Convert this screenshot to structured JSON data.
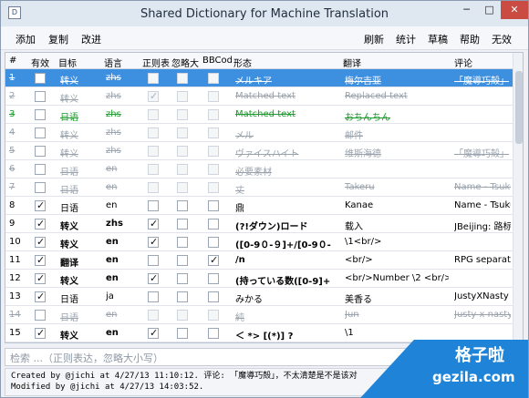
{
  "window": {
    "title": "Shared Dictionary for Machine Translation",
    "icon": "app-icon",
    "min_glyph": "─",
    "max_glyph": "□",
    "close_glyph": "✕"
  },
  "menu": {
    "left": [
      "添加",
      "复制",
      "改进"
    ],
    "right": [
      "刷新",
      "统计",
      "草稿",
      "帮助",
      "无效"
    ]
  },
  "table": {
    "headers": [
      "#",
      "有效",
      "目标",
      "语言",
      "正则表",
      "忽略大",
      "BBCod",
      "形态",
      "翻译",
      "评论"
    ],
    "rows": [
      {
        "n": "1",
        "valid": false,
        "target": "转义",
        "lang": "zhs",
        "regex": false,
        "ignore": false,
        "bbcode": false,
        "form": "メルキア",
        "translation": "梅尔吉亚",
        "comment": "「魔導巧殻」"
      },
      {
        "n": "2",
        "valid": false,
        "target": "转义",
        "lang": "zhs",
        "regex": true,
        "ignore": false,
        "bbcode": false,
        "form": "Matched text",
        "translation": "Replaced text",
        "comment": ""
      },
      {
        "n": "3",
        "valid": false,
        "target": "日语",
        "lang": "zhs",
        "regex": false,
        "ignore": false,
        "bbcode": false,
        "form": "Matched text",
        "translation": "おちんちん",
        "comment": ""
      },
      {
        "n": "4",
        "valid": false,
        "target": "转义",
        "lang": "zhs",
        "regex": false,
        "ignore": false,
        "bbcode": false,
        "form": "メル",
        "translation": "邮件",
        "comment": ""
      },
      {
        "n": "5",
        "valid": false,
        "target": "转义",
        "lang": "zhs",
        "regex": false,
        "ignore": false,
        "bbcode": false,
        "form": "ヴァイスハイト",
        "translation": "维斯海德",
        "comment": "「魔導巧殻」"
      },
      {
        "n": "6",
        "valid": false,
        "target": "日语",
        "lang": "en",
        "regex": false,
        "ignore": false,
        "bbcode": false,
        "form": "必要素材",
        "translation": "",
        "comment": ""
      },
      {
        "n": "7",
        "valid": false,
        "target": "日语",
        "lang": "en",
        "regex": false,
        "ignore": false,
        "bbcode": false,
        "form": "丈",
        "translation": "Takeru",
        "comment": "Name - Tsukum"
      },
      {
        "n": "8",
        "valid": true,
        "target": "日语",
        "lang": "en",
        "regex": false,
        "ignore": false,
        "bbcode": false,
        "form": "鼎",
        "translation": "Kanae",
        "comment": "Name - Tsukum"
      },
      {
        "n": "9",
        "valid": true,
        "target": "转义",
        "lang": "zhs",
        "regex": true,
        "ignore": false,
        "bbcode": false,
        "form": "(?!ダウン)ロード",
        "translation": "载入",
        "comment": "JBeijing: 路标"
      },
      {
        "n": "10",
        "valid": true,
        "target": "转义",
        "lang": "en",
        "regex": true,
        "ignore": false,
        "bbcode": false,
        "form": "([0-9０-９]+/[0-9０-",
        "translation": "\\1<br/>",
        "comment": ""
      },
      {
        "n": "11",
        "valid": true,
        "target": "翻译",
        "lang": "en",
        "regex": false,
        "ignore": false,
        "bbcode": true,
        "form": "/n",
        "translation": "<br/>",
        "comment": "RPG separator"
      },
      {
        "n": "12",
        "valid": true,
        "target": "转义",
        "lang": "en",
        "regex": true,
        "ignore": false,
        "bbcode": false,
        "form": "(持っている数([0-9]+",
        "translation": "<br/>Number \\2 <br/>",
        "comment": ""
      },
      {
        "n": "13",
        "valid": true,
        "target": "日语",
        "lang": "ja",
        "regex": false,
        "ignore": false,
        "bbcode": false,
        "form": "みかる",
        "translation": "美香る",
        "comment": "JustyXNasty"
      },
      {
        "n": "14",
        "valid": false,
        "target": "日语",
        "lang": "en",
        "regex": false,
        "ignore": false,
        "bbcode": false,
        "form": "純",
        "translation": "Jun",
        "comment": "Justy x nasty"
      },
      {
        "n": "15",
        "valid": true,
        "target": "转义",
        "lang": "en",
        "regex": true,
        "ignore": false,
        "bbcode": false,
        "form": "＜ *> [(*)] ?",
        "translation": "\\1",
        "comment": ""
      }
    ]
  },
  "search": {
    "placeholder": "检索 ...（正则表达，忽略大小写）"
  },
  "status": {
    "created": "Created by @jichi at 4/27/13 11:10:12. 评论: 「魔導巧殻」，不太清楚是不是该对",
    "modified": "Modified by @jichi at 4/27/13 14:03:52."
  },
  "watermark": {
    "top": "格子啦",
    "bottom": "gezila.com"
  },
  "colors": {
    "selection": "#3d8fe0",
    "strike_gray": "#9aa3ad",
    "green": "#1b9c2b",
    "close": "#c94b41",
    "watermark": "#1f84d8"
  }
}
